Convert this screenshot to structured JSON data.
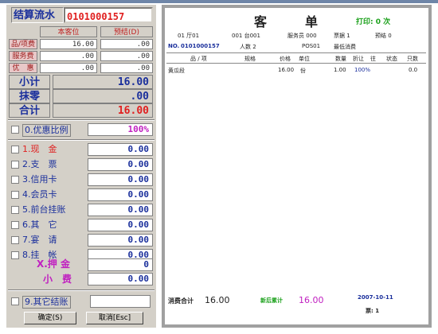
{
  "left_panel": {
    "serial_label": "结算流水",
    "serial_no": "0101000157",
    "columns": {
      "current": "本客位",
      "predict": "预结(D)"
    },
    "rows": [
      {
        "label": "品/项费",
        "current": "16.00",
        "predict": ".00"
      },
      {
        "label": "服务费",
        "current": ".00",
        "predict": ".00"
      },
      {
        "label": "优　惠",
        "current": ".00",
        "predict": ".00"
      }
    ],
    "subtotal_label": "小计",
    "subtotal": "16.00",
    "zero_label": "抹零",
    "zero": ".00",
    "total_label": "合计",
    "total": "16.00",
    "discount_label": "0.优惠比例",
    "discount_value": "100%",
    "payments": [
      {
        "label": "1.现　金",
        "value": "0.00",
        "active": true
      },
      {
        "label": "2.支　票",
        "value": "0.00"
      },
      {
        "label": "3.信用卡",
        "value": "0.00"
      },
      {
        "label": "4.会员卡",
        "value": "0.00"
      },
      {
        "label": "5.前台挂账",
        "value": "0.00"
      },
      {
        "label": "6.其　它",
        "value": "0.00"
      },
      {
        "label": "7.宴　请",
        "value": "0.00"
      },
      {
        "label": "8.挂　帐",
        "value": "0.00"
      }
    ],
    "deposit_label": "X.押 金",
    "deposit": "0",
    "tip_label": "小　费",
    "tip": "0.00",
    "other_label": "9.其它结账",
    "other_value": "",
    "confirm_button": "确定(S)",
    "cancel_button": "取消[Esc]"
  },
  "receipt": {
    "title": "客　　　单",
    "print_label": "打印: 0  次",
    "hall": "01 厅01",
    "table": "001 台001",
    "waiter": "服务员 000",
    "ticket": "票据 1",
    "prepay": "预结 0",
    "no_label": "NO.",
    "no_value": "0101000157",
    "people": "人数 2",
    "pos": "POS01",
    "min_charge": "最低消费",
    "headers": [
      "品 / 项",
      "规格",
      "价格",
      "单位",
      "数量",
      "折让",
      "往",
      "状态",
      "只数"
    ],
    "items": [
      {
        "name": "黄瓜段",
        "price": "16.00",
        "unit": "份",
        "qty": "1.00",
        "discount": "100%",
        "count": "0.0"
      }
    ],
    "total_label": "消费合计",
    "total": "16.00",
    "new_total_label": "新后累计",
    "new_total": "16.00",
    "date": "2007-10-11",
    "ticket_count_label": "票: 1"
  },
  "colors": {
    "accent_blue": "#1a2f9c",
    "red": "#e02020",
    "green": "#1aa01a",
    "panel_gray": "#d4d0c8"
  }
}
